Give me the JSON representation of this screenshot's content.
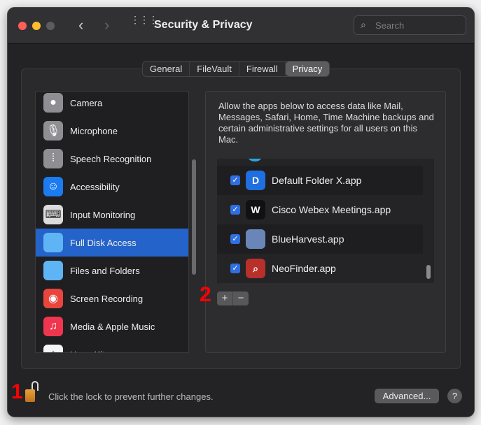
{
  "window": {
    "title": "Security & Privacy",
    "search_placeholder": "Search"
  },
  "tabs": [
    "General",
    "FileVault",
    "Firewall",
    "Privacy"
  ],
  "selected_tab": "Privacy",
  "sidebar": {
    "items": [
      {
        "label": "Camera",
        "icon": "camera-icon",
        "color": "#8e8e93"
      },
      {
        "label": "Microphone",
        "icon": "microphone-icon",
        "color": "#8e8e93"
      },
      {
        "label": "Speech Recognition",
        "icon": "waveform-icon",
        "color": "#8e8e93"
      },
      {
        "label": "Accessibility",
        "icon": "accessibility-icon",
        "color": "#1a7cf0"
      },
      {
        "label": "Input Monitoring",
        "icon": "keyboard-icon",
        "color": "#dcdcdc"
      },
      {
        "label": "Full Disk Access",
        "icon": "folder-icon",
        "color": "#5fb4f5"
      },
      {
        "label": "Files and Folders",
        "icon": "folder-icon",
        "color": "#5fb4f5"
      },
      {
        "label": "Screen Recording",
        "icon": "record-icon",
        "color": "#e8453c"
      },
      {
        "label": "Media & Apple Music",
        "icon": "music-icon",
        "color": "#f0364f"
      },
      {
        "label": "HomeKit",
        "icon": "home-icon",
        "color": "#f5f5f5"
      }
    ],
    "selected": "Full Disk Access"
  },
  "description": "Allow the apps below to access data like Mail, Messages, Safari, Home, Time Machine backups and certain administrative settings for all users on this Mac.",
  "apps": [
    {
      "label": "Default Folder X.app",
      "checked": true,
      "color": "#1f6fe0",
      "glyph": "D"
    },
    {
      "label": "Cisco Webex Meetings.app",
      "checked": true,
      "color": "#111",
      "glyph": "W"
    },
    {
      "label": "BlueHarvest.app",
      "checked": true,
      "color": "#6a86b8",
      "glyph": ""
    },
    {
      "label": "NeoFinder.app",
      "checked": true,
      "color": "#b8302a",
      "glyph": "⌕"
    }
  ],
  "add_label": "+",
  "remove_label": "−",
  "annotations": [
    "1",
    "2"
  ],
  "footer": {
    "lock_text": "Click the lock to prevent further changes.",
    "advanced_label": "Advanced...",
    "help_label": "?"
  }
}
